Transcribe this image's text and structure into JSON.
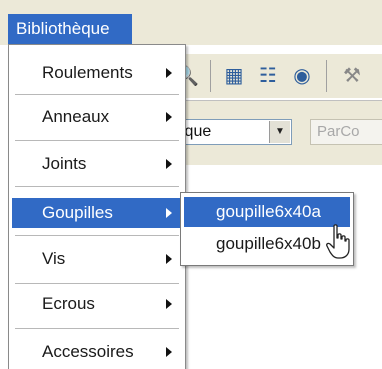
{
  "menubar": {
    "title": "Bibliothèque"
  },
  "background": {
    "toolbar_icons": [
      "magnifier-icon",
      "grid-icon",
      "chart-icon",
      "disk-icon"
    ],
    "combo_value": "ique",
    "field_value": "ParCo"
  },
  "menu": {
    "items": [
      {
        "label": "Roulements",
        "has_submenu": true
      },
      {
        "label": "Anneaux",
        "has_submenu": true
      },
      {
        "label": "Joints",
        "has_submenu": true
      },
      {
        "label": "Goupilles",
        "has_submenu": true,
        "highlighted": true
      },
      {
        "label": "Vis",
        "has_submenu": true
      },
      {
        "label": "Ecrous",
        "has_submenu": true
      },
      {
        "label": "Accessoires",
        "has_submenu": true
      }
    ]
  },
  "submenu": {
    "items": [
      {
        "label": "goupille6x40a",
        "highlighted": true
      },
      {
        "label": "goupille6x40b"
      }
    ]
  },
  "colors": {
    "highlight": "#316ac5",
    "chrome": "#ece9d8"
  }
}
